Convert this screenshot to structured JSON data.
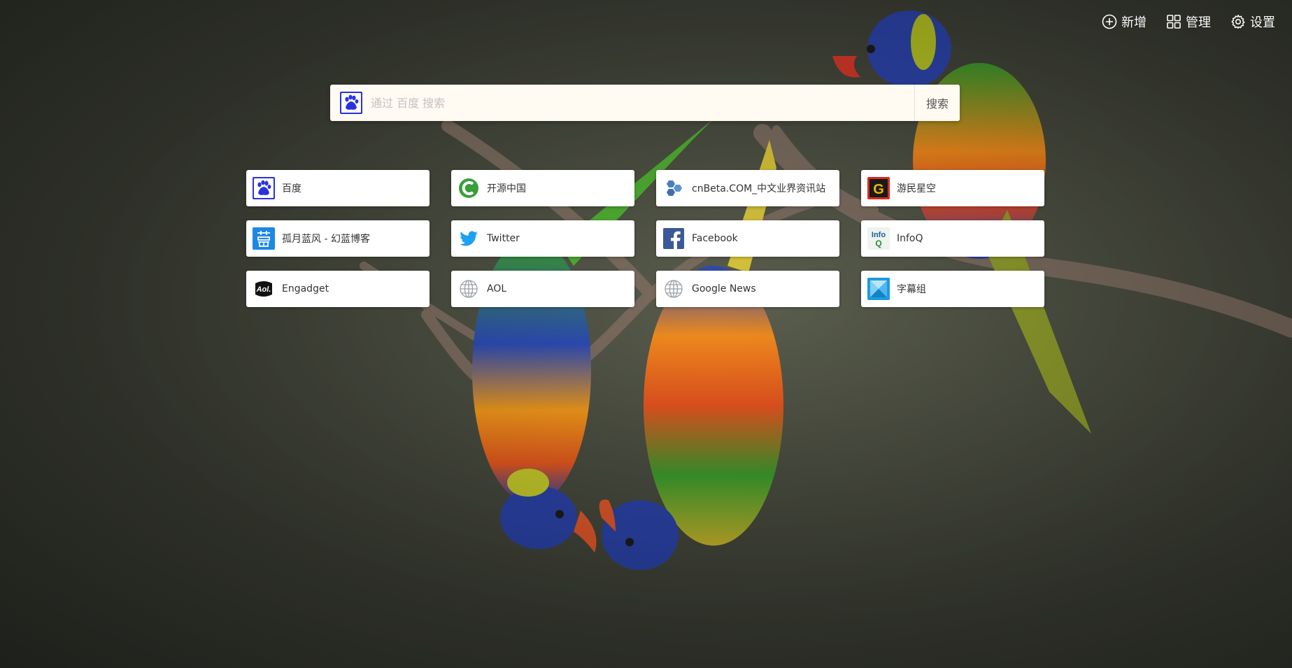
{
  "toolbar": {
    "add_label": "新增",
    "manage_label": "管理",
    "settings_label": "设置"
  },
  "search": {
    "engine_icon": "baidu-paw-icon",
    "placeholder": "通过 百度 搜索",
    "value": "",
    "button_label": "搜索"
  },
  "shortcuts": [
    {
      "label": "百度",
      "icon": "baidu-icon"
    },
    {
      "label": "开源中国",
      "icon": "oschina-icon"
    },
    {
      "label": "cnBeta.COM_中文业界资讯站",
      "icon": "cnbeta-icon"
    },
    {
      "label": "游民星空",
      "icon": "gamersky-icon"
    },
    {
      "label": "孤月蓝风 - 幻蓝博客",
      "icon": "blue-blog-icon"
    },
    {
      "label": "Twitter",
      "icon": "twitter-icon"
    },
    {
      "label": "Facebook",
      "icon": "facebook-icon"
    },
    {
      "label": "InfoQ",
      "icon": "infoq-icon"
    },
    {
      "label": "Engadget",
      "icon": "engadget-icon"
    },
    {
      "label": "AOL",
      "icon": "globe-icon"
    },
    {
      "label": "Google News",
      "icon": "globe-icon"
    },
    {
      "label": "字幕组",
      "icon": "subtitle-group-icon"
    }
  ],
  "colors": {
    "baidu_blue": "#2932e1",
    "oschina_green": "#3a9f3a",
    "cnbeta_blue": "#4a7fbf",
    "gamersky_red": "#d92b1f",
    "twitter_blue": "#1da1f2",
    "facebook_blue": "#3b5998",
    "infoq_blue": "#1a5c9a",
    "subtitle_blue": "#1e9ae0"
  }
}
